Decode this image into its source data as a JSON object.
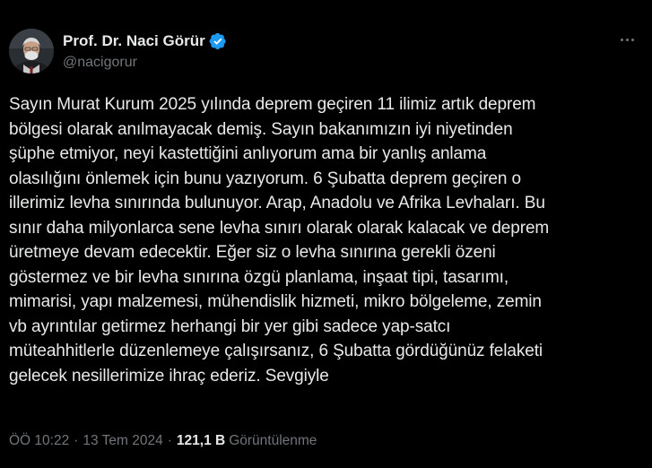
{
  "author": {
    "name": "Prof. Dr. Naci Görür",
    "handle": "@nacigorur",
    "verified": true,
    "avatar_icon": "profile-photo"
  },
  "tweet": {
    "lines": [
      "Sayın Murat Kurum 2025 yılında deprem geçiren 11 ilimiz artık deprem",
      "bölgesi olarak anılmayacak demiş. Sayın bakanımızın iyi niyetinden",
      "şüphe etmiyor, neyi kastettiğini anlıyorum ama bir yanlış anlama",
      "olasılığını önlemek için bunu yazıyorum. 6 Şubatta deprem geçiren o",
      "illerimiz levha sınırında bulunuyor. Arap, Anadolu ve Afrika Levhaları. Bu",
      "sınır daha milyonlarca sene levha sınırı olarak olarak kalacak ve deprem",
      "üretmeye devam edecektir. Eğer siz o levha sınırına gerekli özeni",
      "göstermez ve bir levha sınırına özgü planlama, inşaat tipi, tasarımı,",
      "mimarisi, yapı malzemesi, mühendislik hizmeti, mikro bölgeleme, zemin",
      "vb ayrıntılar getirmez herhangi bir yer gibi sadece yap-satcı",
      "müteahhitlerle düzenlemeye çalışırsanız, 6 Şubatta gördüğünüz felaketi",
      "gelecek nesillerimize ihraç ederiz. Sevgiyle"
    ]
  },
  "meta": {
    "time": "ÖÖ 10:22",
    "separator": "·",
    "date": "13 Tem 2024",
    "views_count": "121,1 B",
    "views_label": "Görüntülenme"
  },
  "colors": {
    "background": "#000000",
    "text": "#e7e9ea",
    "secondary": "#71767b",
    "verified": "#1d9bf0"
  }
}
